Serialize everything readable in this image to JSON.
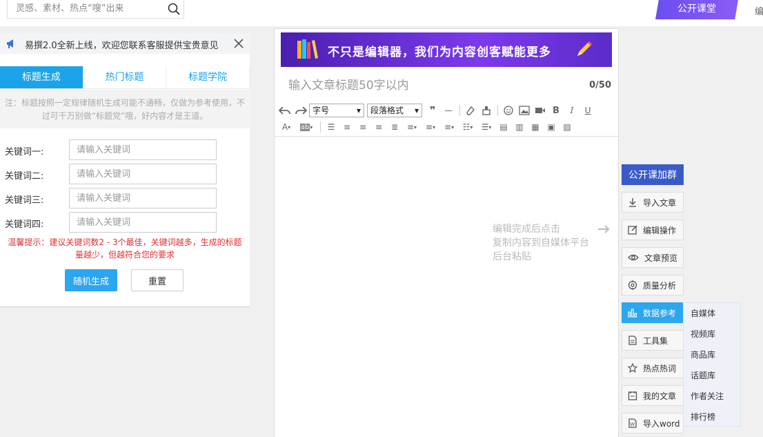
{
  "search": {
    "placeholder": "灵感、素材、热点“嗖”出来"
  },
  "header": {
    "class_tab": "公开课堂",
    "edit_fragment": "编"
  },
  "notice": {
    "text": "易撰2.0全新上线，欢迎您联系客服提供宝贵意见"
  },
  "tabs": [
    {
      "label": "标题生成"
    },
    {
      "label": "热门标题"
    },
    {
      "label": "标题学院"
    }
  ],
  "tip": "注：标题按照一定规律随机生成可能不通畅，仅做为参考使用，不过可千万别做“标题党”哦，好内容才是王道。",
  "keywords": [
    {
      "label": "关键词一:",
      "placeholder": "请输入关键词"
    },
    {
      "label": "关键词二:",
      "placeholder": "请输入关键词"
    },
    {
      "label": "关键词三:",
      "placeholder": "请输入关键词"
    },
    {
      "label": "关键词四:",
      "placeholder": "请输入关键词"
    }
  ],
  "warning": "温馨提示：建议关键词数2 - 3个最佳，关键词越多，生成的标题量越少，但越符合您的要求",
  "buttons": {
    "random": "随机生成",
    "reset": "重置"
  },
  "editor": {
    "banner": "不只是编辑器，我们为内容创客赋能更多",
    "title_placeholder": "输入文章标题50字以内",
    "counter": "0/50",
    "font_size": "字号",
    "paragraph": "段落格式",
    "hint_line1": "编辑完成后点击",
    "hint_line2": "复制内容到自媒体平台",
    "hint_line3": "后台粘贴"
  },
  "side": {
    "group": "公开课加群",
    "items": [
      {
        "label": "导入文章",
        "icon": "download-icon"
      },
      {
        "label": "编辑操作",
        "icon": "edit-icon"
      },
      {
        "label": "文章预览",
        "icon": "eye-icon"
      },
      {
        "label": "质量分析",
        "icon": "target-icon"
      },
      {
        "label": "数据参考",
        "icon": "bar-chart-icon"
      },
      {
        "label": "工具集",
        "icon": "document-icon"
      },
      {
        "label": "热点热词",
        "icon": "star-icon"
      },
      {
        "label": "我的文章",
        "icon": "article-icon"
      },
      {
        "label": "导入word",
        "icon": "word-icon"
      }
    ],
    "submenu": [
      "自媒体",
      "视频库",
      "商品库",
      "话题库",
      "作者关注",
      "排行榜"
    ]
  },
  "colors": {
    "accent": "#1aa3e8",
    "group_button": "#3a5bc7",
    "banner_purple": "#6b2fe0"
  }
}
